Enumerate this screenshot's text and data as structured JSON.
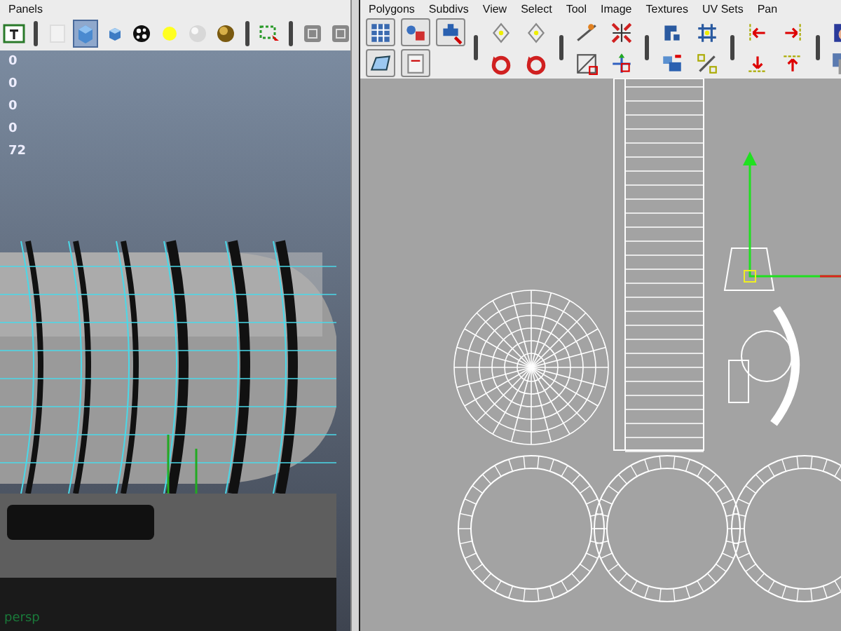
{
  "left_panel": {
    "menu": [
      "Panels"
    ],
    "shading_buttons": [
      {
        "selected": false
      },
      {
        "selected": true
      },
      {
        "selected": false
      },
      {
        "selected": false
      },
      {
        "selected": false
      },
      {
        "selected": false
      },
      {
        "selected": false
      }
    ],
    "hud_values": [
      "0",
      "0",
      "0",
      "0",
      "72"
    ],
    "camera_label": "persp"
  },
  "right_panel": {
    "menu": [
      "Polygons",
      "Subdivs",
      "View",
      "Select",
      "Tool",
      "Image",
      "Textures",
      "UV Sets",
      "Pan"
    ]
  }
}
